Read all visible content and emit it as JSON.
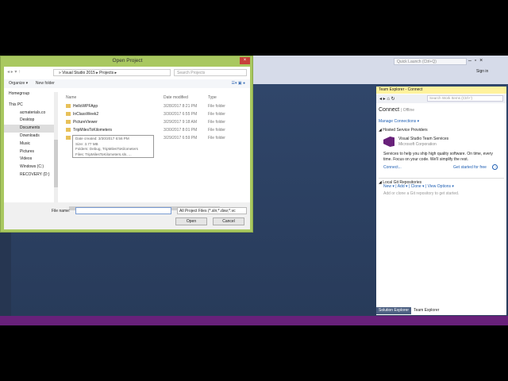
{
  "vs": {
    "quick_launch": "Quick Launch (Ctrl+Q)",
    "sign_in": "Sign in"
  },
  "dialog": {
    "title": "Open Project",
    "close": "×",
    "path": [
      "Visual Studio 2015",
      "Projects"
    ],
    "search_placeholder": "Search Projects",
    "organize": "Organize ▾",
    "new_folder": "New folder",
    "nav": [
      "Homegroup",
      "This PC",
      "acmaterials.co",
      "Desktop",
      "Documents",
      "Downloads",
      "Music",
      "Pictures",
      "Videos",
      "Windows (C:)",
      "RECOVERY (D:)"
    ],
    "columns": [
      "Name",
      "Date modified",
      "Type"
    ],
    "files": [
      {
        "name": "HelloWPFApp",
        "date": "3/28/2017 8:21 PM",
        "type": "File folder"
      },
      {
        "name": "InClassWeek2",
        "date": "3/30/2017 6:55 PM",
        "type": "File folder"
      },
      {
        "name": "PictureViewer",
        "date": "3/29/2017 9:18 AM",
        "type": "File folder"
      },
      {
        "name": "TripMilesToKilometers",
        "date": "3/30/2017 8:01 PM",
        "type": "File folder"
      },
      {
        "name": "",
        "date": "3/29/2017 6:59 PM",
        "type": "File folder"
      }
    ],
    "tooltip": [
      "Date created: 3/30/2017 6:56 PM",
      "Size: 3.77 MB",
      "Folders: Debug, TripMilesToKilometers",
      "Files: TripMilesToKilometers.sln, ..."
    ],
    "file_name_label": "File name:",
    "file_name_value": "",
    "file_type": "All Project Files (*.sln;*.dsw;*.vc",
    "open": "Open",
    "cancel": "Cancel"
  },
  "team_explorer": {
    "title": "Team Explorer - Connect",
    "search_placeholder": "Search Work Items (Ctrl+')",
    "connect": "Connect",
    "offline": "| Offline",
    "manage": "Manage Connections ▾",
    "hosted": "◢ Hosted Service Providers",
    "vsts": "Visual Studio Team Services",
    "corp": "Microsoft Corporation",
    "desc": "Services to help you ship high quality software. On time, every time. Focus on your code. We'll simplify the rest.",
    "connect_link": "Connect...",
    "get_started": "Get started for free",
    "local_git": "◢ Local Git Repositories",
    "git_actions": [
      "New ▾",
      "Add ▾",
      "Clone ▾",
      "View Options ▾"
    ],
    "git_hint": "Add or clone a Git repository to get started."
  },
  "tabs": [
    "Solution Explorer",
    "Team Explorer"
  ],
  "colors": {
    "vs_purple": "#68217a",
    "dialog_border": "#a9c860",
    "editor_bg": "#2d4265"
  }
}
